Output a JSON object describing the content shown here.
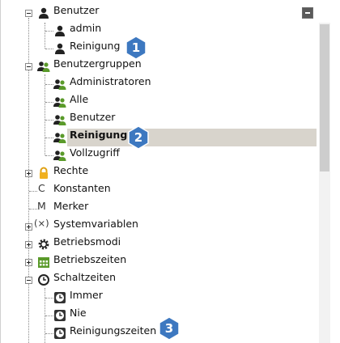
{
  "tree": {
    "nodes": {
      "benutzer": "Benutzer",
      "admin": "admin",
      "reinigung_user": "Reinigung",
      "benutzergruppen": "Benutzergruppen",
      "administratoren": "Administratoren",
      "alle": "Alle",
      "benutzer_group": "Benutzer",
      "reinigung_group": "Reinigung",
      "vollzugriff": "Vollzugriff",
      "rechte": "Rechte",
      "konstanten": "Konstanten",
      "merker": "Merker",
      "systemvariablen": "Systemvariablen",
      "betriebsmodi": "Betriebsmodi",
      "betriebszeiten": "Betriebszeiten",
      "schaltzeiten": "Schaltzeiten",
      "immer": "Immer",
      "nie": "Nie",
      "reinigungszeiten": "Reinigungszeiten"
    },
    "type_glyphs": {
      "konstanten": "C",
      "merker": "M",
      "systemvariablen": "(×)"
    },
    "selected": "reinigung_group"
  },
  "callouts": {
    "one": "1",
    "two": "2",
    "three": "3"
  },
  "colors": {
    "callout_blue": "#3d78c0",
    "selection_bg": "#d8d4cc",
    "group_green": "#5a9a2a"
  }
}
